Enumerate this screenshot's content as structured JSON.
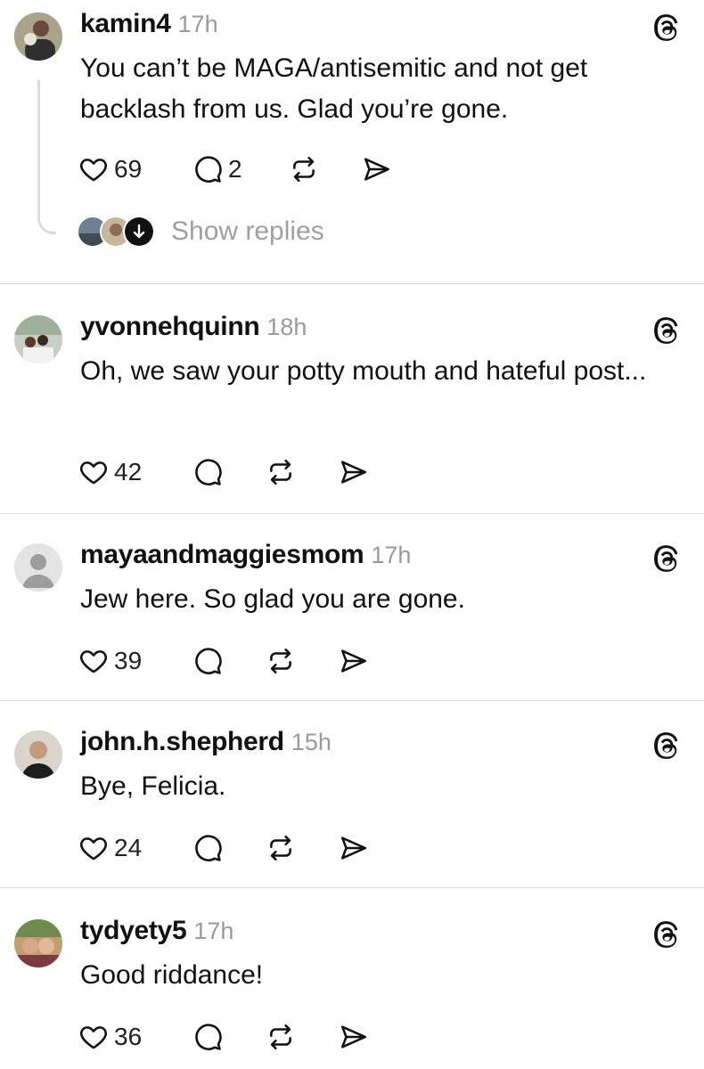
{
  "posts": [
    {
      "username": "kamin4",
      "time": "17h",
      "text": "You can’t be MAGA/antisemitic and not get backlash from us. Glad you’re gone.",
      "likes": "69",
      "replies": "2",
      "show_replies": "Show replies"
    },
    {
      "username": "yvonnehquinn",
      "time": "18h",
      "text": "Oh, we saw your potty mouth and hateful post...",
      "likes": "42",
      "replies": ""
    },
    {
      "username": "mayaandmaggiesmom",
      "time": "17h",
      "text": "Jew here. So glad you are gone.",
      "likes": "39",
      "replies": ""
    },
    {
      "username": "john.h.shepherd",
      "time": "15h",
      "text": "Bye, Felicia.",
      "likes": "24",
      "replies": ""
    },
    {
      "username": "tydyety5",
      "time": "17h",
      "text": "Good riddance!",
      "likes": "36",
      "replies": ""
    }
  ],
  "icons": {
    "like": "heart-icon",
    "reply": "comment-bubble-icon",
    "repost": "repost-icon",
    "share": "send-icon",
    "brand": "threads-logo-icon"
  },
  "colors": {
    "text": "#111111",
    "muted": "#9a9a9a",
    "divider": "#dcdcdc"
  }
}
